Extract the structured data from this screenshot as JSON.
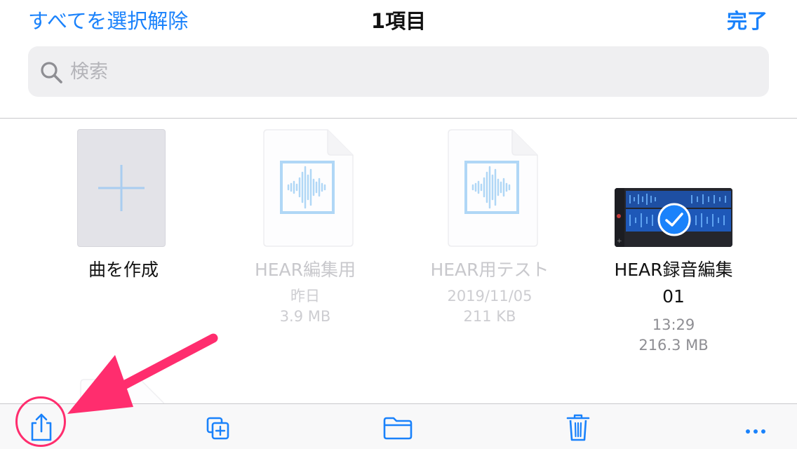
{
  "header": {
    "deselect_all": "すべてを選択解除",
    "title": "1項目",
    "done": "完了"
  },
  "search": {
    "placeholder": "検索",
    "value": ""
  },
  "items": [
    {
      "name": "曲を作成",
      "kind": "create",
      "dim": false
    },
    {
      "name": "HEAR編集用",
      "date": "昨日",
      "size": "3.9 MB",
      "kind": "audio",
      "dim": true
    },
    {
      "name": "HEAR用テスト",
      "date": "2019/11/05",
      "size": "211 KB",
      "kind": "audio",
      "dim": true
    },
    {
      "name_line1": "HEAR録音編集",
      "name_line2": "01",
      "date": "13:29",
      "size": "216.3 MB",
      "kind": "video",
      "selected": true,
      "dim": false
    }
  ],
  "toolbar": {
    "buttons": [
      "share-icon",
      "duplicate-icon",
      "folder-icon",
      "trash-icon",
      "more-icon"
    ]
  },
  "colors": {
    "accent": "#1a82fb",
    "annotation": "#ff2d6e",
    "waveform": "#8ec6f4"
  }
}
